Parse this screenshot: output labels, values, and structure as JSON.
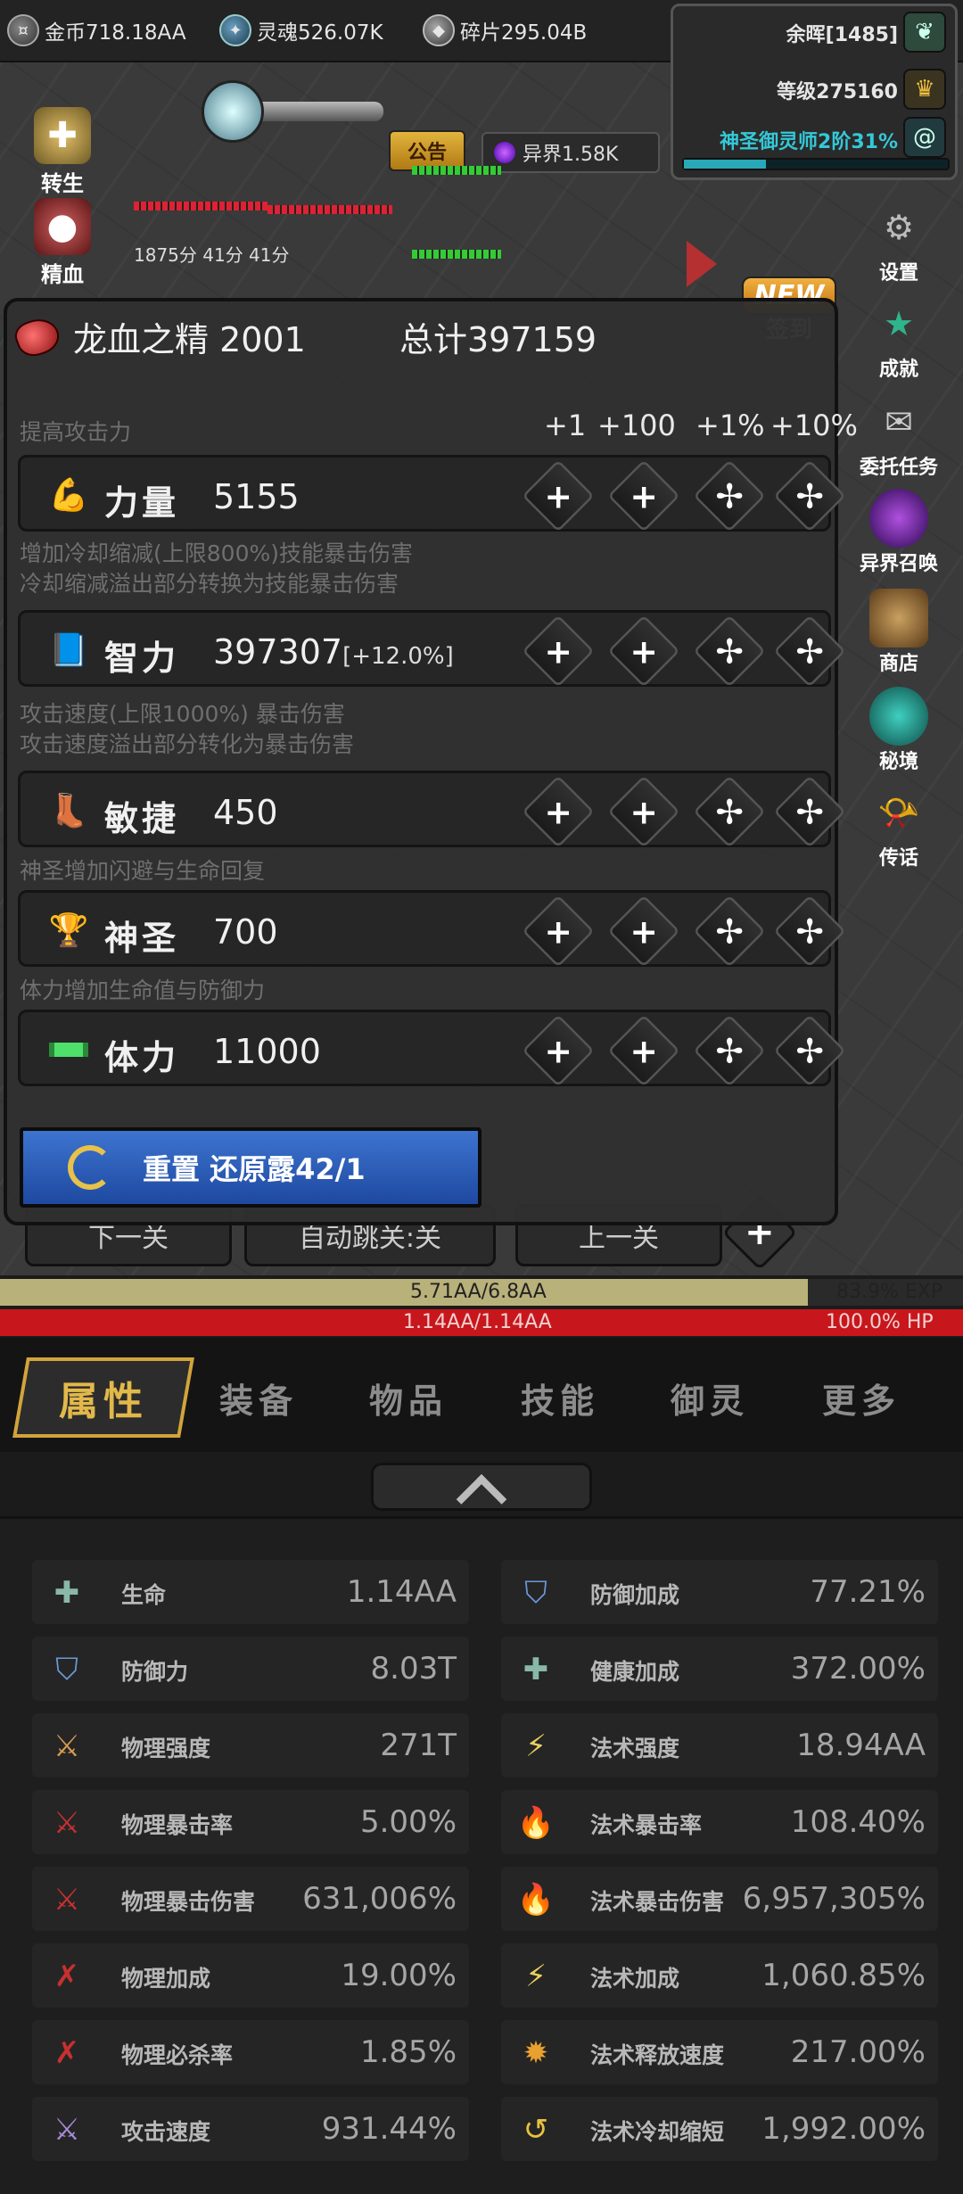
{
  "currencies": [
    {
      "icon": "gold-coin-icon",
      "label": "金币718.18AA"
    },
    {
      "icon": "soul-icon",
      "label": "灵魂526.07K"
    },
    {
      "icon": "shard-icon",
      "label": "碎片295.04B"
    }
  ],
  "status": {
    "glow": "余晖[1485]",
    "level": "等级275160",
    "rank": "神圣御灵师2阶31%",
    "rank_progress": 0.31
  },
  "scene": {
    "notice_label": "公告",
    "otherworld_label": "异界1.58K",
    "score_text": "1875分  41分   41分",
    "left_menu": [
      {
        "icon": "cross-icon",
        "label": "转生"
      },
      {
        "icon": "blood-essence-icon",
        "label": "精血"
      }
    ],
    "new_badge": "NEW",
    "sign_in_label": "签到",
    "right_menu": [
      {
        "icon": "gear-icon",
        "label": "设置"
      },
      {
        "icon": "star-icon",
        "label": "成就"
      },
      {
        "icon": "quest-scroll-icon",
        "label": "委托任务"
      },
      {
        "icon": "portal-icon",
        "label": "异界召唤"
      },
      {
        "icon": "shop-icon",
        "label": "商店"
      },
      {
        "icon": "secret-realm-icon",
        "label": "秘境"
      },
      {
        "icon": "horn-icon",
        "label": "传话"
      }
    ],
    "nav": {
      "next": "下一关",
      "auto": "自动跳关:关",
      "prev": "上一关"
    }
  },
  "alloc": {
    "resource_name": "龙血之精 2001",
    "total": "总计397159",
    "step_labels": [
      "+1",
      "+100",
      "+1%",
      "+10%"
    ],
    "stats": [
      {
        "desc": [
          "提高攻击力"
        ],
        "icon": "strength-arm-icon",
        "name": "力量",
        "value": "5155",
        "bonus": ""
      },
      {
        "desc": [
          "增加冷却缩减(上限800%)技能暴击伤害",
          "冷却缩减溢出部分转换为技能暴击伤害"
        ],
        "icon": "book-icon",
        "name": "智力",
        "value": "397307",
        "bonus": "[+12.0%]"
      },
      {
        "desc": [
          "攻击速度(上限1000%) 暴击伤害",
          "攻击速度溢出部分转化为暴击伤害"
        ],
        "icon": "boot-icon",
        "name": "敏捷",
        "value": "450",
        "bonus": ""
      },
      {
        "desc": [
          "神圣增加闪避与生命回复"
        ],
        "icon": "trophy-icon",
        "name": "神圣",
        "value": "700",
        "bonus": ""
      },
      {
        "desc": [
          "体力增加生命值与防御力"
        ],
        "icon": "stamina-bar-icon",
        "name": "体力",
        "value": "11000",
        "bonus": ""
      }
    ],
    "reset_label": "重置 还原露42/1"
  },
  "bars": {
    "exp_text": "5.71AA/6.8AA",
    "exp_pct_text": "83.9% EXP",
    "exp_progress": 0.839,
    "hp_text": "1.14AA/1.14AA",
    "hp_pct_text": "100.0%   HP",
    "hp_progress": 1.0
  },
  "tabs": [
    "属性",
    "装备",
    "物品",
    "技能",
    "御灵",
    "更多"
  ],
  "attributes": [
    {
      "icon": "health-cross-icon",
      "name": "生命",
      "value": "1.14AA"
    },
    {
      "icon": "shield-icon",
      "name": "防御加成",
      "value": "77.21%"
    },
    {
      "icon": "shield-icon",
      "name": "防御力",
      "value": "8.03T"
    },
    {
      "icon": "health-cross-icon",
      "name": "健康加成",
      "value": "372.00%"
    },
    {
      "icon": "physical-sword-icon",
      "name": "物理强度",
      "value": "271T"
    },
    {
      "icon": "lightning-icon",
      "name": "法术强度",
      "value": "18.94AA"
    },
    {
      "icon": "physical-crit-icon",
      "name": "物理暴击率",
      "value": "5.00%"
    },
    {
      "icon": "blue-flame-icon",
      "name": "法术暴击率",
      "value": "108.40%"
    },
    {
      "icon": "physical-crit-icon",
      "name": "物理暴击伤害",
      "value": "631,006%"
    },
    {
      "icon": "blue-flame-icon",
      "name": "法术暴击伤害",
      "value": "6,957,305%"
    },
    {
      "icon": "physical-bonus-icon",
      "name": "物理加成",
      "value": "19.00%"
    },
    {
      "icon": "lightning-icon",
      "name": "法术加成",
      "value": "1,060.85%"
    },
    {
      "icon": "physical-bonus-icon",
      "name": "物理必杀率",
      "value": "1.85%"
    },
    {
      "icon": "cast-speed-icon",
      "name": "法术释放速度",
      "value": "217.00%"
    },
    {
      "icon": "attack-speed-icon",
      "name": "攻击速度",
      "value": "931.44%"
    },
    {
      "icon": "cooldown-icon",
      "name": "法术冷却缩短",
      "value": "1,992.00%"
    }
  ]
}
